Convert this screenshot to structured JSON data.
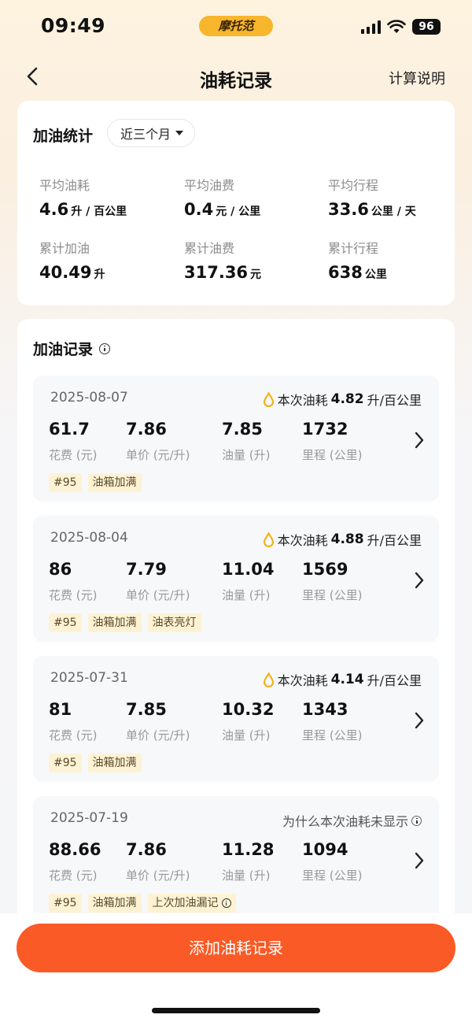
{
  "status_bar": {
    "time": "09:49",
    "brand": "摩托范",
    "battery": "96"
  },
  "nav": {
    "title": "油耗记录",
    "action": "计算说明"
  },
  "stats": {
    "title": "加油统计",
    "period": "近三个月",
    "items": [
      {
        "label": "平均油耗",
        "value": "4.6",
        "unit": "升 / 百公里"
      },
      {
        "label": "平均油费",
        "value": "0.4",
        "unit": "元 / 公里"
      },
      {
        "label": "平均行程",
        "value": "33.6",
        "unit": "公里 / 天"
      },
      {
        "label": "累计加油",
        "value": "40.49",
        "unit": "升"
      },
      {
        "label": "累计油费",
        "value": "317.36",
        "unit": "元"
      },
      {
        "label": "累计行程",
        "value": "638",
        "unit": "公里"
      }
    ]
  },
  "records": {
    "title": "加油记录",
    "labels": {
      "cost": "花费 (元)",
      "price": "单价 (元/升)",
      "volume": "油量 (升)",
      "mileage": "里程 (公里)"
    },
    "eff_prefix": "本次油耗",
    "eff_suffix": "升/百公里",
    "items": [
      {
        "date": "2025-08-07",
        "eff": "4.82",
        "cost": "61.7",
        "price": "7.86",
        "volume": "7.85",
        "mileage": "1732",
        "tags": [
          "#95",
          "油箱加满"
        ]
      },
      {
        "date": "2025-08-04",
        "eff": "4.88",
        "cost": "86",
        "price": "7.79",
        "volume": "11.04",
        "mileage": "1569",
        "tags": [
          "#95",
          "油箱加满",
          "油表亮灯"
        ]
      },
      {
        "date": "2025-07-31",
        "eff": "4.14",
        "cost": "81",
        "price": "7.85",
        "volume": "10.32",
        "mileage": "1343",
        "tags": [
          "#95",
          "油箱加满"
        ]
      },
      {
        "date": "2025-07-19",
        "note": "为什么本次油耗未显示",
        "cost": "88.66",
        "price": "7.86",
        "volume": "11.28",
        "mileage": "1094",
        "tags": [
          "#95",
          "油箱加满",
          "上次加油漏记"
        ]
      }
    ]
  },
  "add_button": "添加油耗记录"
}
